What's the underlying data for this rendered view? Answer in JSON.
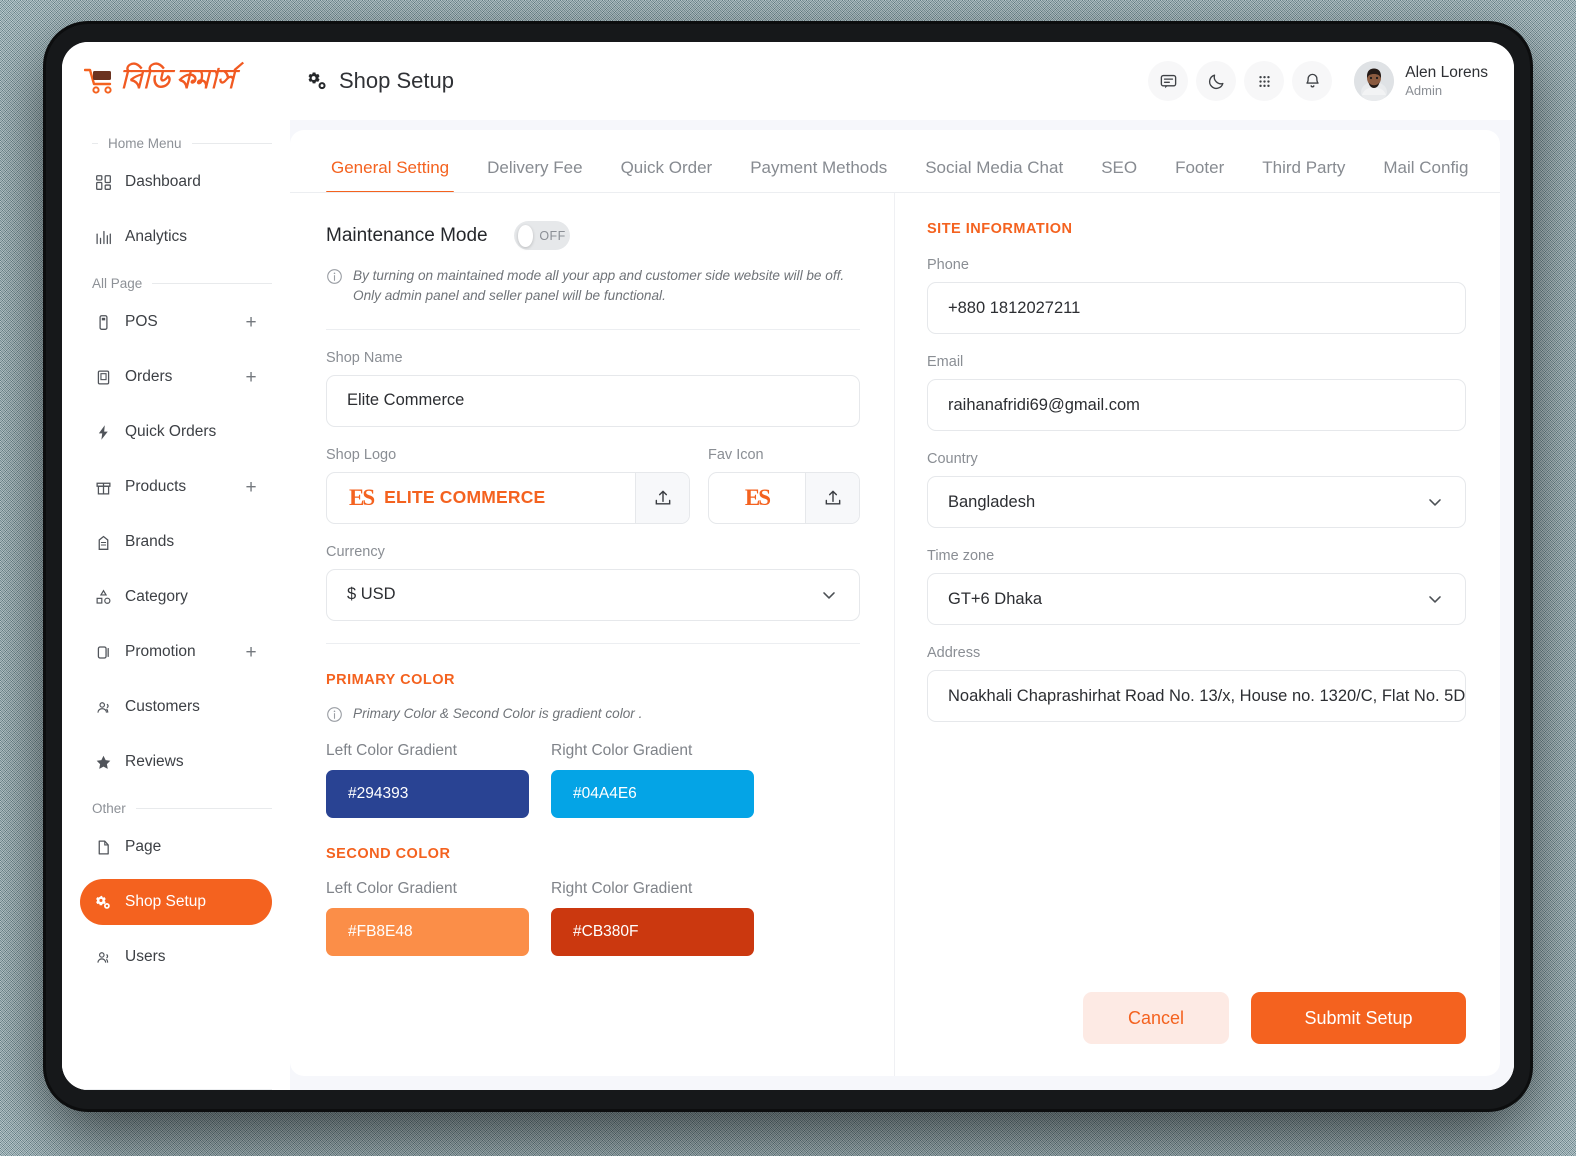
{
  "brand": {
    "logo_text": "বিডি কমার্স",
    "logo_icon": "shopping-cart-icon"
  },
  "header": {
    "page_title": "Shop Setup",
    "page_title_icon": "gears-icon",
    "actions": [
      {
        "name": "messages",
        "icon": "chat-bubble-icon"
      },
      {
        "name": "dark-mode",
        "icon": "moon-icon"
      },
      {
        "name": "apps",
        "icon": "grid-dots-icon"
      },
      {
        "name": "notifications",
        "icon": "bell-icon"
      }
    ],
    "user": {
      "name": "Alen Lorens",
      "role": "Admin",
      "avatar": "user-avatar-photo"
    }
  },
  "sidebar": {
    "groups": [
      {
        "label": "Home Menu"
      },
      {
        "label": "All Page"
      },
      {
        "label": "Other"
      }
    ],
    "items": [
      {
        "label": "Dashboard",
        "icon": "dashboard-icon",
        "expandable": false,
        "active": false
      },
      {
        "label": "Analytics",
        "icon": "analytics-icon",
        "expandable": false,
        "active": false
      },
      {
        "label": "POS",
        "icon": "pos-icon",
        "expandable": true,
        "active": false
      },
      {
        "label": "Orders",
        "icon": "orders-icon",
        "expandable": true,
        "active": false
      },
      {
        "label": "Quick Orders",
        "icon": "lightning-icon",
        "expandable": false,
        "active": false
      },
      {
        "label": "Products",
        "icon": "products-icon",
        "expandable": true,
        "active": false
      },
      {
        "label": "Brands",
        "icon": "brands-icon",
        "expandable": false,
        "active": false
      },
      {
        "label": "Category",
        "icon": "category-icon",
        "expandable": false,
        "active": false
      },
      {
        "label": "Promotion",
        "icon": "promotion-icon",
        "expandable": true,
        "active": false
      },
      {
        "label": "Customers",
        "icon": "customers-icon",
        "expandable": false,
        "active": false
      },
      {
        "label": "Reviews",
        "icon": "star-icon",
        "expandable": false,
        "active": false
      },
      {
        "label": "Page",
        "icon": "page-icon",
        "expandable": false,
        "active": false
      },
      {
        "label": "Shop Setup",
        "icon": "gears-icon",
        "expandable": false,
        "active": true
      },
      {
        "label": "Users",
        "icon": "users-icon",
        "expandable": false,
        "active": false
      }
    ],
    "expand_symbol": "+"
  },
  "tabs": [
    {
      "label": "General Setting",
      "active": true
    },
    {
      "label": "Delivery Fee",
      "active": false
    },
    {
      "label": "Quick Order",
      "active": false
    },
    {
      "label": "Payment Methods",
      "active": false
    },
    {
      "label": "Social Media Chat",
      "active": false
    },
    {
      "label": "SEO",
      "active": false
    },
    {
      "label": "Footer",
      "active": false
    },
    {
      "label": "Third Party",
      "active": false
    },
    {
      "label": "Mail Config",
      "active": false
    }
  ],
  "general": {
    "maintenance_label": "Maintenance Mode",
    "maintenance_state": "OFF",
    "maintenance_hint": "By turning on maintained mode all your app and customer side website will be off. Only admin panel and seller panel will be functional.",
    "shop_name_label": "Shop  Name",
    "shop_name_value": "Elite Commerce",
    "shop_logo_label": "Shop Logo",
    "shop_logo_mark": "ES",
    "shop_logo_word": "ELITE COMMERCE",
    "fav_icon_label": "Fav Icon",
    "fav_icon_mark": "ES",
    "currency_label": "Currency",
    "currency_value": "$ USD"
  },
  "colors": {
    "primary_title": "PRIMARY COLOR",
    "second_title": "SECOND COLOR",
    "gradient_hint": "Primary Color & Second Color is gradient color .",
    "left_label": "Left Color Gradient",
    "right_label": "Right Color Gradient",
    "primary_left": "#294393",
    "primary_right": "#04A4E6",
    "second_left": "#FB8E48",
    "second_right": "#CB380F"
  },
  "site_information": {
    "title": "SITE INFORMATION",
    "phone_label": "Phone",
    "phone_value": "+880 1812027211",
    "email_label": "Email",
    "email_value": "raihanafridi69@gmail.com",
    "country_label": "Country",
    "country_value": "Bangladesh",
    "timezone_label": "Time zone",
    "timezone_value": "GT+6 Dhaka",
    "address_label": "Address",
    "address_value": "Noakhali Chaprashirhat Road No. 13/x, House no. 1320/C, Flat No. 5D"
  },
  "footer_actions": {
    "cancel_label": "Cancel",
    "submit_label": "Submit Setup"
  },
  "theme": {
    "accent": "#F4621F",
    "accent_soft": "#FDEAE4",
    "text": "#2C2E32",
    "muted": "#8A8E94"
  }
}
